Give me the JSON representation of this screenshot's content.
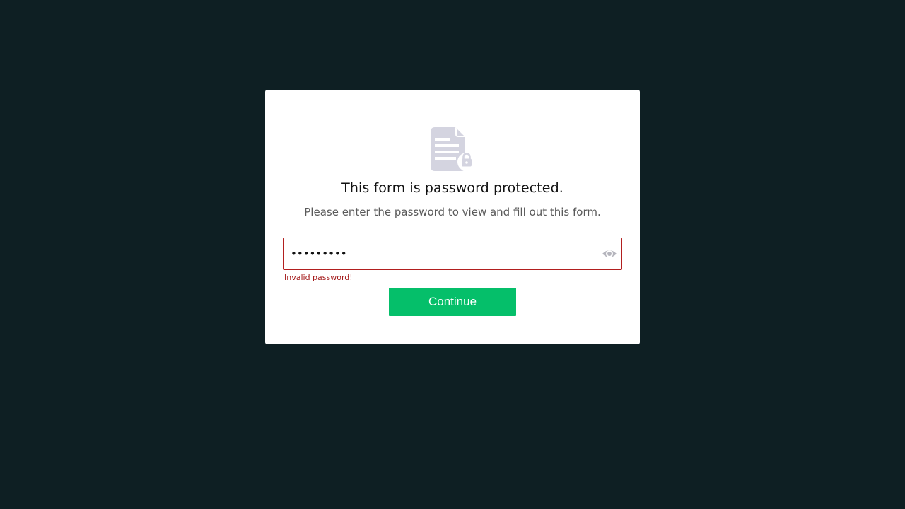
{
  "colors": {
    "background": "#0e1f23",
    "card": "#ffffff",
    "accent": "#05bf6a",
    "error": "#a31818",
    "icon": "#d4d4e0"
  },
  "card": {
    "icon": "document-lock-icon",
    "title": "This form is password protected.",
    "subtitle": "Please enter the password to view and fill out this form."
  },
  "password": {
    "value": "•••••••••",
    "toggle_icon": "eye-icon",
    "error": "Invalid password!"
  },
  "continue_button": {
    "label": "Continue"
  }
}
